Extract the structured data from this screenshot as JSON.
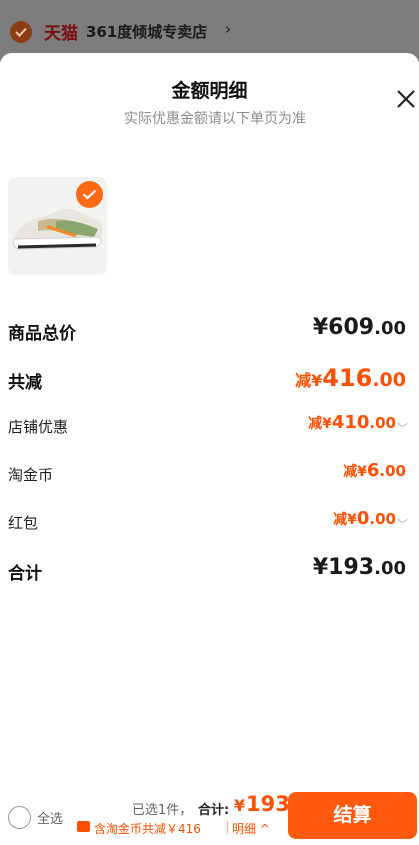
{
  "store": {
    "brand": "天猫",
    "name": "361度倾城专卖店",
    "chevron": "›"
  },
  "sheet": {
    "title": "金额明细",
    "subtitle": "实际优惠金额请以下单页为准",
    "close_icon": "close-icon"
  },
  "product": {
    "thumbnail_icon": "sneaker-image",
    "selected": true
  },
  "rows": {
    "goods_total": {
      "label": "商品总价",
      "currency": "¥",
      "integer": "609",
      "decimal": ".00"
    },
    "total_discount": {
      "label": "共减",
      "prefix": "减",
      "currency": "¥",
      "integer": "416",
      "decimal": ".00"
    },
    "shop_discount": {
      "label": "店铺优惠",
      "prefix": "减",
      "currency": "¥",
      "integer": "410",
      "decimal": ".00",
      "chevron": "﹀"
    },
    "coins": {
      "label": "淘金币",
      "prefix": "减",
      "currency": "¥",
      "integer": "6",
      "decimal": ".00"
    },
    "red_packet": {
      "label": "红包",
      "prefix": "减",
      "currency": "¥",
      "integer": "0",
      "decimal": ".00",
      "chevron": "﹀"
    },
    "sum": {
      "label": "合计",
      "currency": "¥",
      "integer": "193",
      "decimal": ".00"
    }
  },
  "bottom_bar": {
    "select_all": "全选",
    "selected_count": "已选1件，",
    "total_label": "合计:",
    "currency": "¥",
    "total_amount": "193",
    "discount_text": "含淘金币共减￥416",
    "detail_link": "明细 ^",
    "checkout": "结算"
  },
  "colors": {
    "accent": "#ff5000",
    "checkout_bg": "#ff5a0d",
    "subtitle": "#8c8c8c"
  }
}
